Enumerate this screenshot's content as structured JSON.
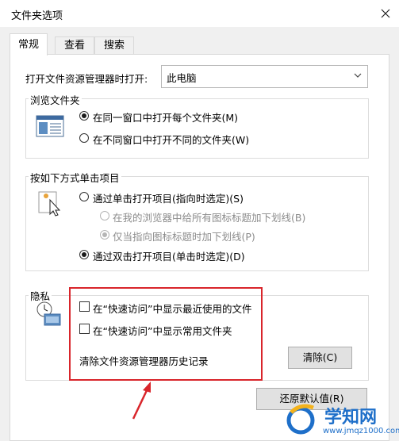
{
  "window": {
    "title": "文件夹选项"
  },
  "tabs": [
    {
      "label": "常规"
    },
    {
      "label": "查看"
    },
    {
      "label": "搜索"
    }
  ],
  "open_explorer": {
    "label": "打开文件资源管理器时打开:",
    "value": "此电脑"
  },
  "browse": {
    "title": "浏览文件夹",
    "options": [
      {
        "label": "在同一窗口中打开每个文件夹(M)",
        "selected": true
      },
      {
        "label": "在不同窗口中打开不同的文件夹(W)",
        "selected": false
      }
    ]
  },
  "click": {
    "title": "按如下方式单击项目",
    "single": "通过单击打开项目(指向时选定)(S)",
    "underline_all": "在我的浏览器中给所有图标标题加下划线(B)",
    "underline_point": "仅当指向图标标题时加下划线(P)",
    "double": "通过双击打开项目(单击时选定)(D)"
  },
  "privacy": {
    "title": "隐私",
    "recent": "在“快速访问”中显示最近使用的文件",
    "frequent": "在“快速访问”中显示常用文件夹",
    "clear_label": "清除文件资源管理器历史记录",
    "clear_button": "清除(C)"
  },
  "restore_button": "还原默认值(R)",
  "watermark": {
    "text": "学知网",
    "url": "www.jmqz1000.com"
  },
  "colors": {
    "annotation": "#d9252b",
    "watermark": "#1e6fc9"
  }
}
